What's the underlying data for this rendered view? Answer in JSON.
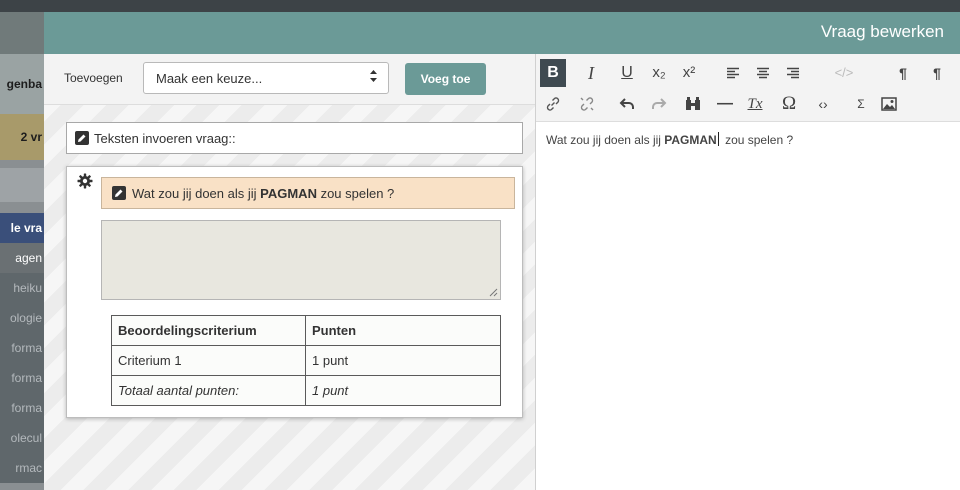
{
  "background": {
    "sidebar_cells": [
      "genba",
      "2 vr"
    ],
    "nav_items": [
      "le vra",
      "agen",
      "heiku",
      "ologie",
      "forma",
      "forma",
      "forma",
      "olecul",
      "rmac"
    ]
  },
  "modal": {
    "title": "Vraag bewerken"
  },
  "left_pane": {
    "add_label": "Toevoegen",
    "type_select": {
      "value": "Maak een keuze...",
      "arrows": "⇕"
    },
    "add_button": "Voeg toe",
    "text_input_label": "Teksten invoeren  vraag::",
    "question": {
      "prefix": "Wat zou jij doen als jij ",
      "bold": "PAGMAN",
      "suffix": "  zou spelen ?"
    },
    "criteria_table": {
      "headers": [
        "Beoordelingscriterium",
        "Punten"
      ],
      "rows": [
        [
          "Criterium 1",
          "1 punt"
        ],
        [
          "Totaal aantal punten:",
          "1 punt"
        ]
      ]
    }
  },
  "editor": {
    "toolbar_row1": [
      "B",
      "I",
      "U",
      "x₂",
      "x²",
      "align-left",
      "align-center",
      "align-right",
      "</>",
      "¶",
      "¶"
    ],
    "toolbar_row2": [
      "link",
      "unlink",
      "undo",
      "redo",
      "find",
      "—",
      "Tx",
      "Ω",
      "‹›",
      "Σ",
      "image"
    ],
    "content": {
      "prefix": "Wat zou jij doen als jij ",
      "bold": "PAGMAN",
      "suffix": " zou spelen ?"
    }
  },
  "colors": {
    "teal": "#6b9a97",
    "question_bg": "#f9e1c6",
    "answer_bg": "#e8e7df"
  }
}
